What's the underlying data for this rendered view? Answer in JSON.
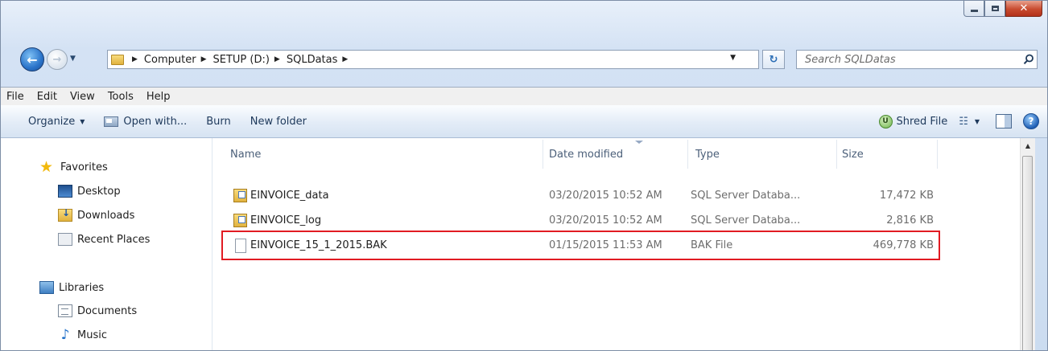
{
  "address": {
    "crumbs": [
      "Computer",
      "SETUP (D:)",
      "SQLDatas"
    ]
  },
  "search": {
    "placeholder": "Search SQLDatas"
  },
  "menu": [
    "File",
    "Edit",
    "View",
    "Tools",
    "Help"
  ],
  "toolbar": {
    "organize": "Organize",
    "open_with": "Open with...",
    "burn": "Burn",
    "new_folder": "New folder",
    "shred": "Shred File"
  },
  "nav": {
    "favorites": "Favorites",
    "desktop": "Desktop",
    "downloads": "Downloads",
    "recent_places": "Recent Places",
    "libraries": "Libraries",
    "documents": "Documents",
    "music": "Music"
  },
  "columns": {
    "name": "Name",
    "date": "Date modified",
    "type": "Type",
    "size": "Size"
  },
  "files": [
    {
      "name": "EINVOICE_data",
      "date": "03/20/2015 10:52 AM",
      "type": "SQL Server Databa...",
      "size": "17,472 KB"
    },
    {
      "name": "EINVOICE_log",
      "date": "03/20/2015 10:52 AM",
      "type": "SQL Server Databa...",
      "size": "2,816 KB"
    },
    {
      "name": "EINVOICE_15_1_2015.BAK",
      "date": "01/15/2015 11:53 AM",
      "type": "BAK File",
      "size": "469,778 KB"
    }
  ],
  "colors": {
    "highlight": "#e11b22",
    "close_button": "#c84b2f"
  }
}
